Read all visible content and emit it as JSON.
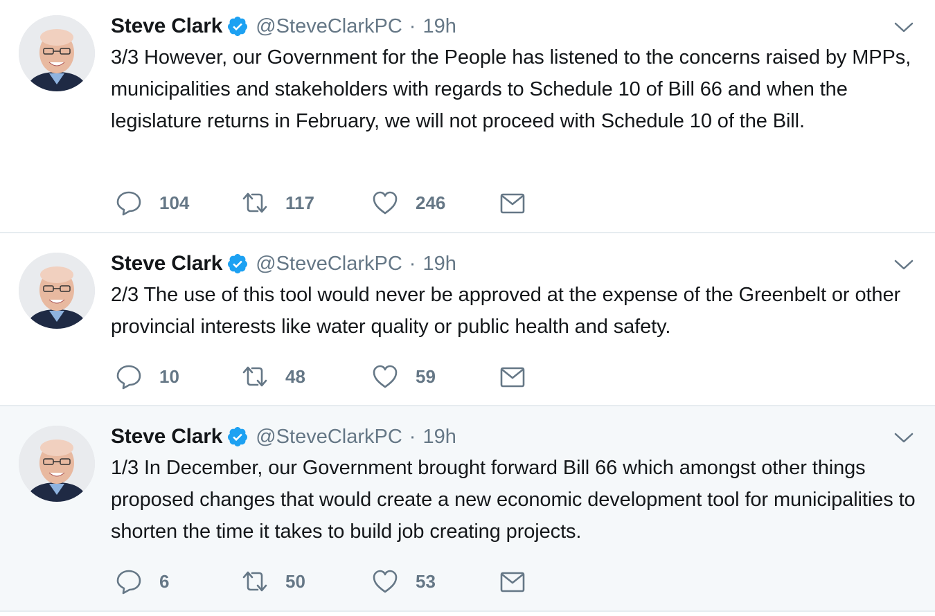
{
  "colors": {
    "primary_text": "#14171a",
    "secondary_text": "#657786",
    "verified_blue": "#1da1f2",
    "divider": "#e6ecf0",
    "highlight_bg": "#f5f8fa"
  },
  "icons": {
    "reply": "speech-bubble-icon",
    "retweet": "retweet-arrows-icon",
    "like": "heart-outline-icon",
    "dm": "envelope-icon",
    "verified": "verified-badge-icon",
    "menu": "chevron-down-icon"
  },
  "tweets": [
    {
      "name": "Steve Clark",
      "handle": "@SteveClarkPC",
      "separator": "·",
      "time": "19h",
      "text": "3/3 However, our Government for the People has listened to the concerns raised by MPPs, municipalities and stakeholders with regards to Schedule 10 of Bill 66 and when the legislature returns in February, we will not proceed with Schedule 10 of the Bill.",
      "replies": "104",
      "retweets": "117",
      "likes": "246",
      "highlighted": false
    },
    {
      "name": "Steve Clark",
      "handle": "@SteveClarkPC",
      "separator": "·",
      "time": "19h",
      "text": "2/3 The use of this tool would never be approved at the expense of the Greenbelt or other provincial interests like water quality or public health and safety.",
      "replies": "10",
      "retweets": "48",
      "likes": "59",
      "highlighted": false
    },
    {
      "name": "Steve Clark",
      "handle": "@SteveClarkPC",
      "separator": "·",
      "time": "19h",
      "text": "1/3 In December, our Government brought forward Bill 66 which amongst other things proposed changes that would create a new economic development tool for municipalities to shorten the time it takes to build job creating projects.",
      "replies": "6",
      "retweets": "50",
      "likes": "53",
      "highlighted": true
    }
  ]
}
